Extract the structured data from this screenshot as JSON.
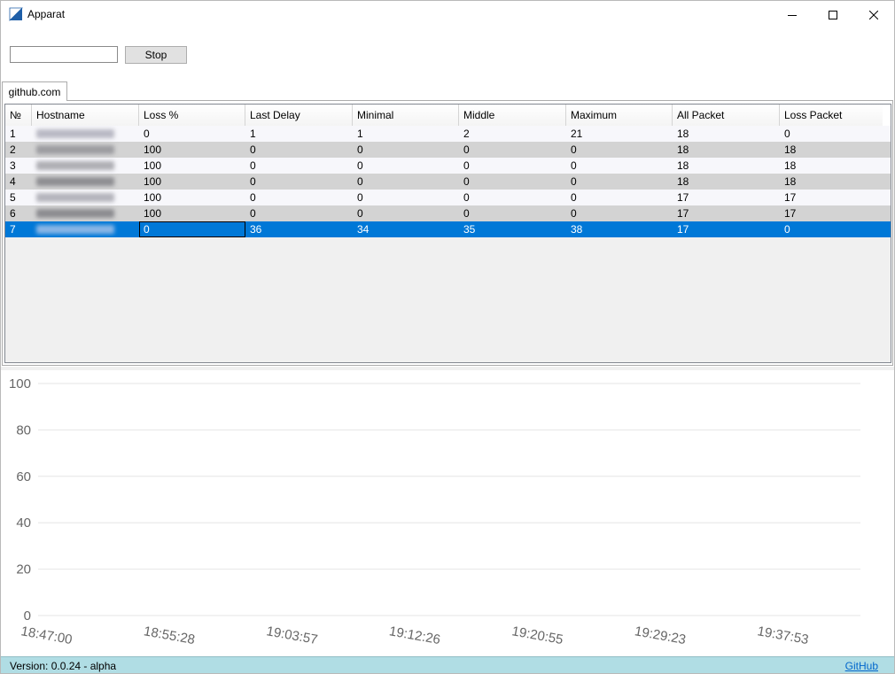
{
  "window": {
    "title": "Apparat"
  },
  "toolbar": {
    "host_value": "",
    "stop_label": "Stop"
  },
  "tabs": [
    {
      "label": "github.com"
    }
  ],
  "table": {
    "columns": [
      "№",
      "Hostname",
      "Loss %",
      "Last Delay",
      "Minimal",
      "Middle",
      "Maximum",
      "All Packet",
      "Loss Packet"
    ],
    "rows": [
      {
        "no": "1",
        "hostname": "",
        "loss": "0",
        "last_delay": "1",
        "minimal": "1",
        "middle": "2",
        "maximum": "21",
        "all_packet": "18",
        "loss_packet": "0"
      },
      {
        "no": "2",
        "hostname": "",
        "loss": "100",
        "last_delay": "0",
        "minimal": "0",
        "middle": "0",
        "maximum": "0",
        "all_packet": "18",
        "loss_packet": "18"
      },
      {
        "no": "3",
        "hostname": "",
        "loss": "100",
        "last_delay": "0",
        "minimal": "0",
        "middle": "0",
        "maximum": "0",
        "all_packet": "18",
        "loss_packet": "18"
      },
      {
        "no": "4",
        "hostname": "",
        "loss": "100",
        "last_delay": "0",
        "minimal": "0",
        "middle": "0",
        "maximum": "0",
        "all_packet": "18",
        "loss_packet": "18"
      },
      {
        "no": "5",
        "hostname": "",
        "loss": "100",
        "last_delay": "0",
        "minimal": "0",
        "middle": "0",
        "maximum": "0",
        "all_packet": "17",
        "loss_packet": "17"
      },
      {
        "no": "6",
        "hostname": "",
        "loss": "100",
        "last_delay": "0",
        "minimal": "0",
        "middle": "0",
        "maximum": "0",
        "all_packet": "17",
        "loss_packet": "17"
      },
      {
        "no": "7",
        "hostname": "",
        "loss": "0",
        "last_delay": "36",
        "minimal": "34",
        "middle": "35",
        "maximum": "38",
        "all_packet": "17",
        "loss_packet": "0"
      }
    ],
    "selected_row": 6
  },
  "chart_data": {
    "type": "line",
    "title": "",
    "xlabel": "",
    "ylabel": "",
    "ylim": [
      0,
      100
    ],
    "yticks": [
      "0",
      "20",
      "40",
      "60",
      "80",
      "100"
    ],
    "xticks": [
      "18:47:00",
      "18:55:28",
      "19:03:57",
      "19:12:26",
      "19:20:55",
      "19:29:23",
      "19:37:53"
    ],
    "grid": true,
    "series": []
  },
  "status": {
    "version": "Version: 0.0.24 - alpha",
    "link_label": "GitHub"
  },
  "colors": {
    "selection": "#0078d7",
    "status_bar": "#b0dde4",
    "link": "#0066cc",
    "row_alt": "#d3d3d3"
  }
}
